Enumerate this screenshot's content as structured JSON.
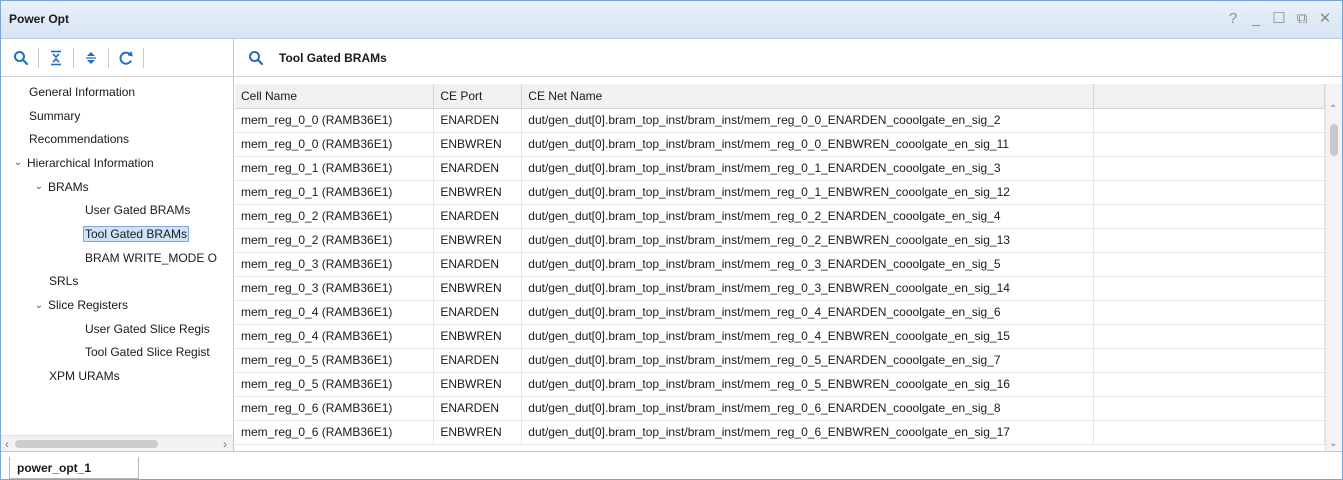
{
  "window": {
    "title": "Power Opt",
    "controls": [
      "?",
      "_",
      "☐",
      "⧉",
      "✕"
    ]
  },
  "left_toolbar": {
    "icons": [
      "search-icon",
      "collapse-all-icon",
      "expand-all-icon",
      "refresh-icon"
    ]
  },
  "tree": [
    {
      "label": "General Information",
      "depth": 0
    },
    {
      "label": "Summary",
      "depth": 0
    },
    {
      "label": "Recommendations",
      "depth": 0
    },
    {
      "label": "Hierarchical Information",
      "depth": 0,
      "expanded": true
    },
    {
      "label": "BRAMs",
      "depth": 1,
      "expanded": true
    },
    {
      "label": "User Gated BRAMs",
      "depth": 2
    },
    {
      "label": "Tool Gated BRAMs",
      "depth": 2,
      "selected": true
    },
    {
      "label": "BRAM WRITE_MODE O",
      "depth": 2
    },
    {
      "label": "SRLs",
      "depth": 1
    },
    {
      "label": "Slice Registers",
      "depth": 1,
      "expanded": true
    },
    {
      "label": "User Gated Slice Regis",
      "depth": 2
    },
    {
      "label": "Tool Gated Slice Regist",
      "depth": 2
    },
    {
      "label": "XPM URAMs",
      "depth": 1
    }
  ],
  "right_panel": {
    "title": "Tool Gated BRAMs"
  },
  "table": {
    "columns": [
      "Cell Name",
      "CE Port",
      "CE Net Name",
      ""
    ],
    "rows": [
      [
        "mem_reg_0_0 (RAMB36E1)",
        "ENARDEN",
        "dut/gen_dut[0].bram_top_inst/bram_inst/mem_reg_0_0_ENARDEN_cooolgate_en_sig_2"
      ],
      [
        "mem_reg_0_0 (RAMB36E1)",
        "ENBWREN",
        "dut/gen_dut[0].bram_top_inst/bram_inst/mem_reg_0_0_ENBWREN_cooolgate_en_sig_11"
      ],
      [
        "mem_reg_0_1 (RAMB36E1)",
        "ENARDEN",
        "dut/gen_dut[0].bram_top_inst/bram_inst/mem_reg_0_1_ENARDEN_cooolgate_en_sig_3"
      ],
      [
        "mem_reg_0_1 (RAMB36E1)",
        "ENBWREN",
        "dut/gen_dut[0].bram_top_inst/bram_inst/mem_reg_0_1_ENBWREN_cooolgate_en_sig_12"
      ],
      [
        "mem_reg_0_2 (RAMB36E1)",
        "ENARDEN",
        "dut/gen_dut[0].bram_top_inst/bram_inst/mem_reg_0_2_ENARDEN_cooolgate_en_sig_4"
      ],
      [
        "mem_reg_0_2 (RAMB36E1)",
        "ENBWREN",
        "dut/gen_dut[0].bram_top_inst/bram_inst/mem_reg_0_2_ENBWREN_cooolgate_en_sig_13"
      ],
      [
        "mem_reg_0_3 (RAMB36E1)",
        "ENARDEN",
        "dut/gen_dut[0].bram_top_inst/bram_inst/mem_reg_0_3_ENARDEN_cooolgate_en_sig_5"
      ],
      [
        "mem_reg_0_3 (RAMB36E1)",
        "ENBWREN",
        "dut/gen_dut[0].bram_top_inst/bram_inst/mem_reg_0_3_ENBWREN_cooolgate_en_sig_14"
      ],
      [
        "mem_reg_0_4 (RAMB36E1)",
        "ENARDEN",
        "dut/gen_dut[0].bram_top_inst/bram_inst/mem_reg_0_4_ENARDEN_cooolgate_en_sig_6"
      ],
      [
        "mem_reg_0_4 (RAMB36E1)",
        "ENBWREN",
        "dut/gen_dut[0].bram_top_inst/bram_inst/mem_reg_0_4_ENBWREN_cooolgate_en_sig_15"
      ],
      [
        "mem_reg_0_5 (RAMB36E1)",
        "ENARDEN",
        "dut/gen_dut[0].bram_top_inst/bram_inst/mem_reg_0_5_ENARDEN_cooolgate_en_sig_7"
      ],
      [
        "mem_reg_0_5 (RAMB36E1)",
        "ENBWREN",
        "dut/gen_dut[0].bram_top_inst/bram_inst/mem_reg_0_5_ENBWREN_cooolgate_en_sig_16"
      ],
      [
        "mem_reg_0_6 (RAMB36E1)",
        "ENARDEN",
        "dut/gen_dut[0].bram_top_inst/bram_inst/mem_reg_0_6_ENARDEN_cooolgate_en_sig_8"
      ],
      [
        "mem_reg_0_6 (RAMB36E1)",
        "ENBWREN",
        "dut/gen_dut[0].bram_top_inst/bram_inst/mem_reg_0_6_ENBWREN_cooolgate_en_sig_17"
      ]
    ]
  },
  "bottom_tab": {
    "label": "power_opt_1"
  },
  "colors": {
    "accent": "#1f6fc4",
    "selection_bg": "#cfe2f7",
    "selection_border": "#7ea8d8",
    "header_bg": "#f1f1f1"
  }
}
